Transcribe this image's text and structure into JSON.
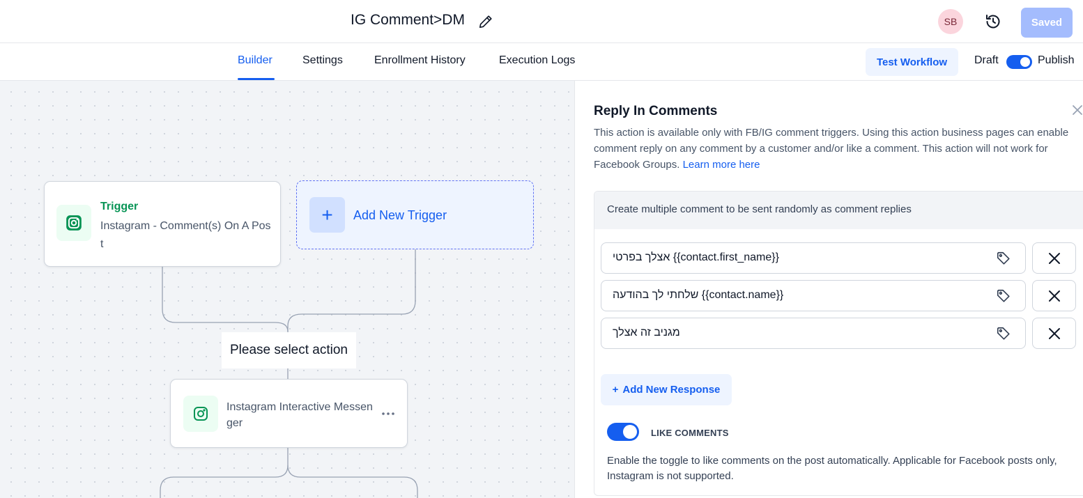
{
  "header": {
    "workflow_title": "IG Comment>DM",
    "avatar_initials": "SB",
    "saved_label": "Saved"
  },
  "tabs": [
    {
      "label": "Builder",
      "active": true
    },
    {
      "label": "Settings",
      "active": false
    },
    {
      "label": "Enrollment History",
      "active": false
    },
    {
      "label": "Execution Logs",
      "active": false
    }
  ],
  "toolbar": {
    "test_workflow_label": "Test Workflow",
    "draft_label": "Draft",
    "publish_label": "Publish",
    "publish_on": true
  },
  "canvas": {
    "trigger": {
      "title": "Trigger",
      "description": "Instagram - Comment(s) On A Post"
    },
    "add_trigger_label": "Add New Trigger",
    "select_action_label": "Please select action",
    "action_node_label": "Instagram Interactive Messenger"
  },
  "panel": {
    "title": "Reply In Comments",
    "description": "This action is available only with FB/IG comment triggers. Using this action business pages can enable comment reply on any comment by a customer and/or like a comment. This action will not work for Facebook Groups.",
    "learn_more": "Learn more here",
    "responses_header": "Create multiple comment to be sent randomly as comment replies",
    "responses": [
      "{{contact.first_name}} אצלך בפרטי",
      "{{contact.name}} שלחתי לך בהודעה",
      "מגניב זה אצלך"
    ],
    "add_response_label": "Add New Response",
    "like_comments_label": "LIKE COMMENTS",
    "like_comments_on": true,
    "like_comments_desc": "Enable the toggle to like comments on the post automatically. Applicable for Facebook posts only, Instagram is not supported."
  },
  "colors": {
    "primary": "#155eef",
    "trigger_green": "#079455",
    "canvas_bg": "#f2f4f7"
  }
}
